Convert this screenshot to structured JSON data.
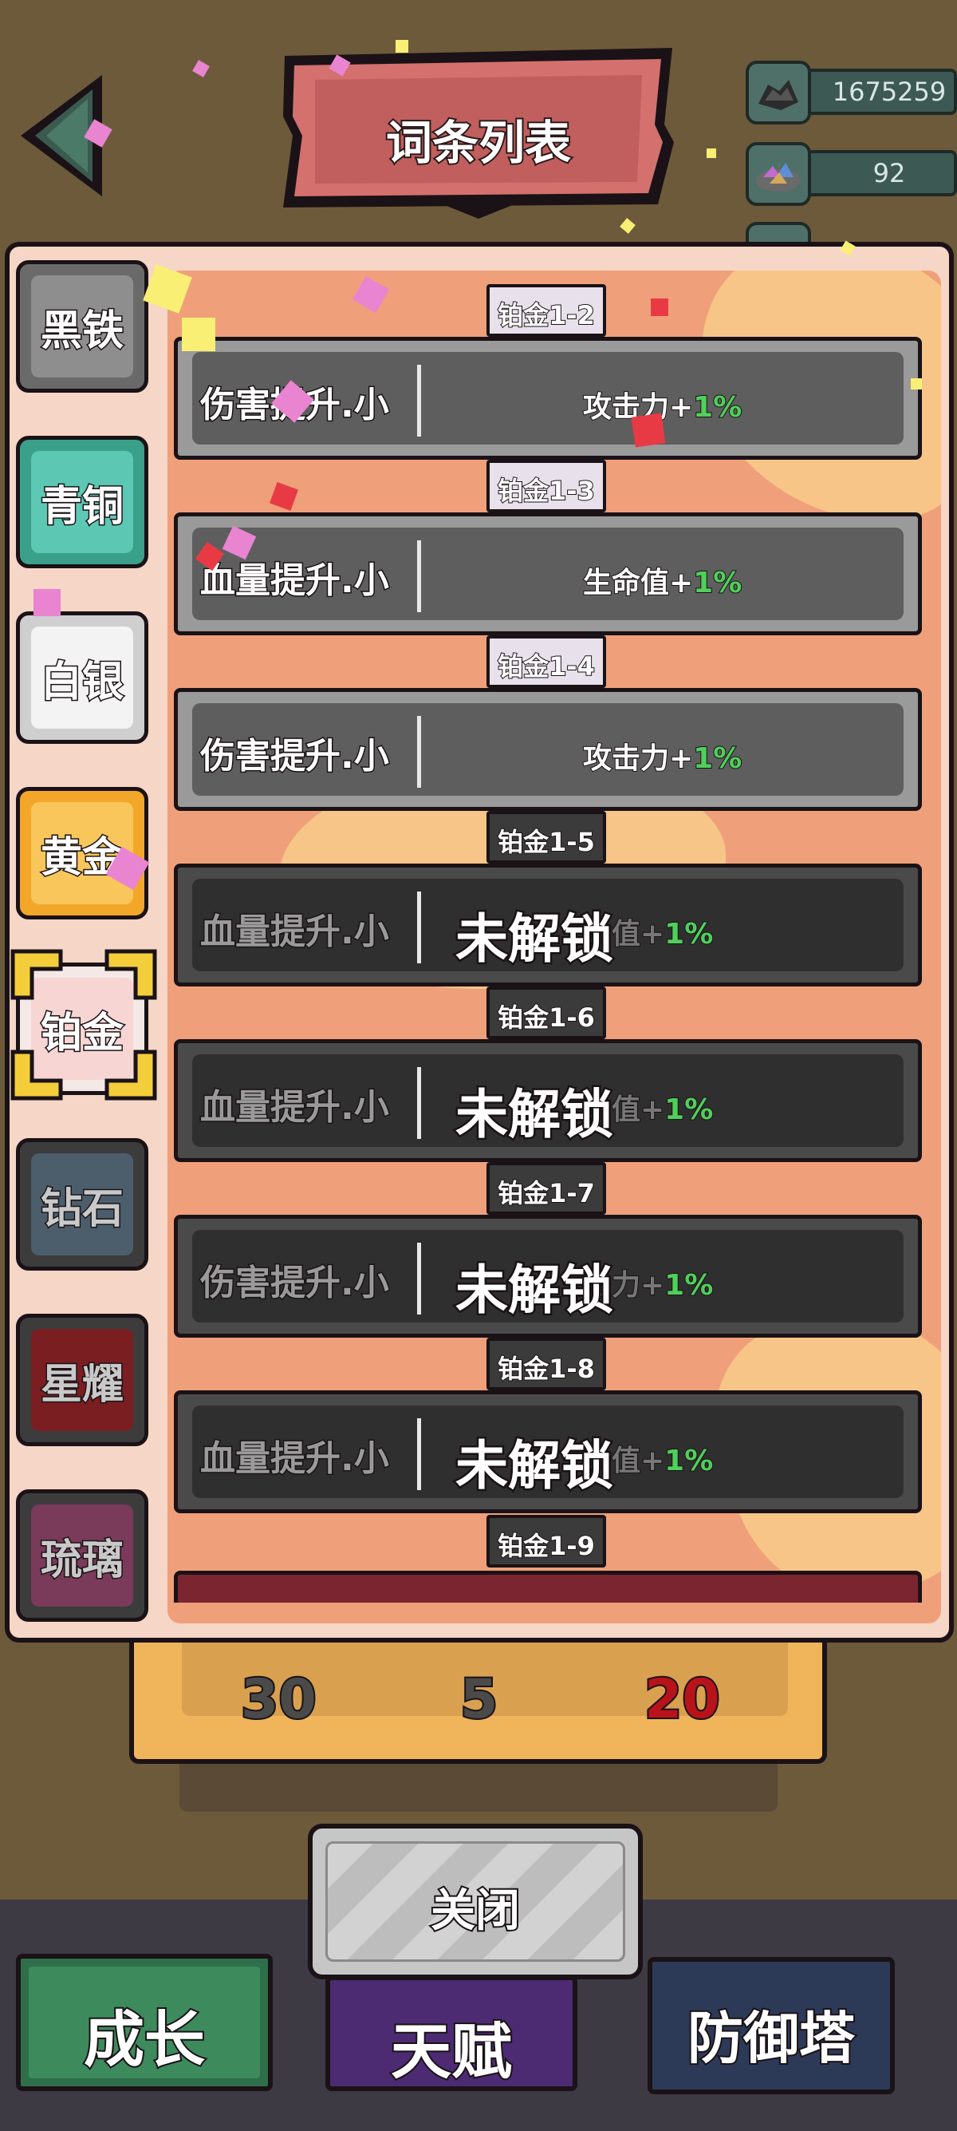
{
  "header": {
    "title": "词条列表"
  },
  "resources": [
    {
      "icon": "dark-ore-icon",
      "value": "1675259"
    },
    {
      "icon": "gem-pile-icon",
      "value": "92"
    }
  ],
  "tiers": [
    {
      "label": "黑铁",
      "color": "#6a6a6a",
      "face": "#8e8e8e"
    },
    {
      "label": "青铜",
      "color": "#3aa08a",
      "face": "#5cc8b4"
    },
    {
      "label": "白银",
      "color": "#cfcfcf",
      "face": "#f3f3f3"
    },
    {
      "label": "黄金",
      "color": "#f3a72a",
      "face": "#f8c65a"
    },
    {
      "label": "铂金",
      "color": "#f4e9e6",
      "face": "#f7d5d3",
      "selected": true
    },
    {
      "label": "钻石",
      "color": "#3c3c3c",
      "face": "#4c5e6c",
      "locked": true
    },
    {
      "label": "星耀",
      "color": "#3c3c3c",
      "face": "#7a1e22",
      "locked": true
    },
    {
      "label": "琉璃",
      "color": "#3c3c3c",
      "face": "#7a3a5a",
      "locked": true
    }
  ],
  "entries": [
    {
      "tag": "铂金1-2",
      "name": "伤害提升.小",
      "effect": "攻击力+",
      "percent": "1%",
      "locked": false
    },
    {
      "tag": "铂金1-3",
      "name": "血量提升.小",
      "effect": "生命值+",
      "percent": "1%",
      "locked": false
    },
    {
      "tag": "铂金1-4",
      "name": "伤害提升.小",
      "effect": "攻击力+",
      "percent": "1%",
      "locked": false
    },
    {
      "tag": "铂金1-5",
      "name": "血量提升.小",
      "effect": "命值+",
      "percent": "1%",
      "locked": true
    },
    {
      "tag": "铂金1-6",
      "name": "血量提升.小",
      "effect": "命值+",
      "percent": "1%",
      "locked": true
    },
    {
      "tag": "铂金1-7",
      "name": "伤害提升.小",
      "effect": "击力+",
      "percent": "1%",
      "locked": true
    },
    {
      "tag": "铂金1-8",
      "name": "血量提升.小",
      "effect": "命值+",
      "percent": "1%",
      "locked": true
    }
  ],
  "next_tag": "铂金1-9",
  "locked_label": "未解锁",
  "rewards": [
    "30",
    "5",
    "20"
  ],
  "close_label": "关闭",
  "nav": [
    {
      "label": "成长",
      "icon": "growth-tab"
    },
    {
      "label": "天赋",
      "icon": "talent-tab"
    },
    {
      "label": "防御塔",
      "icon": "tower-tab"
    }
  ]
}
